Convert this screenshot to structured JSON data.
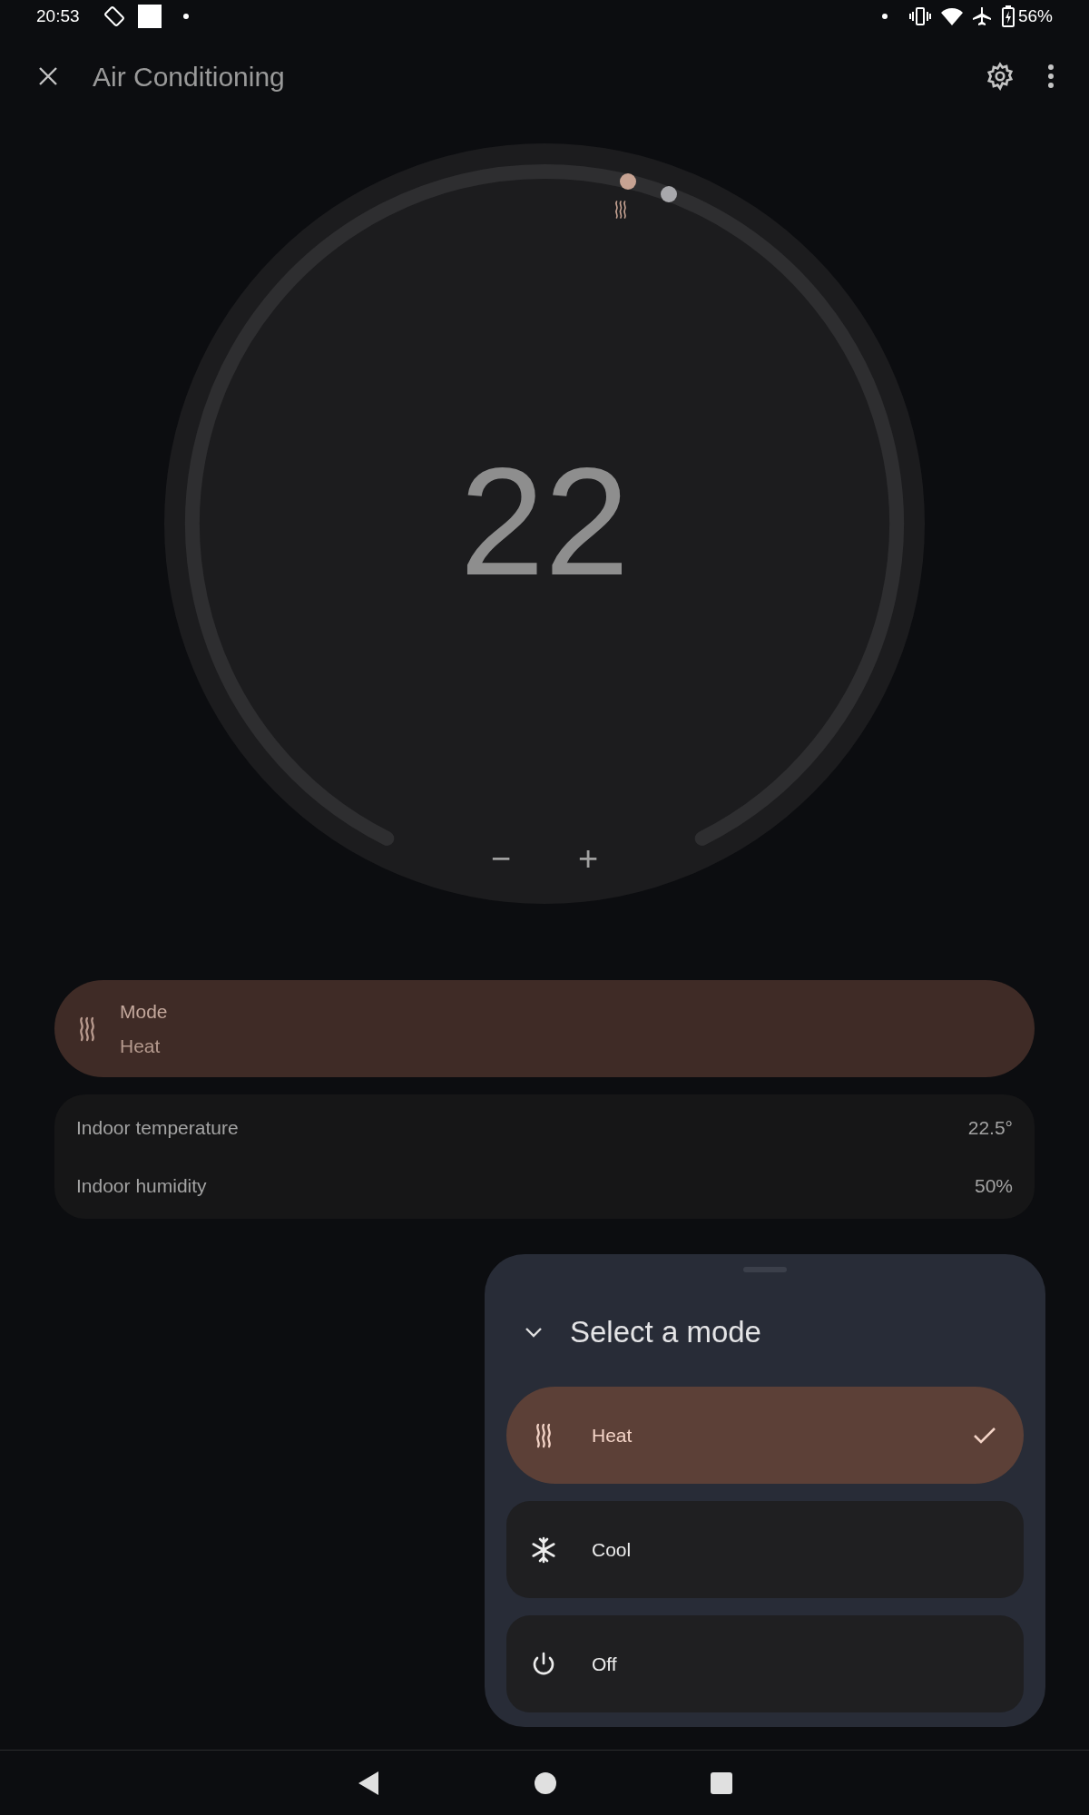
{
  "status_bar": {
    "time": "20:53",
    "battery": "56%"
  },
  "top_bar": {
    "title": "Air Conditioning"
  },
  "thermostat": {
    "setpoint": "22",
    "buttons": [
      "−",
      "+"
    ]
  },
  "mode_card": {
    "label": "Mode",
    "value": "Heat",
    "kind": "heat"
  },
  "readings": [
    {
      "label": "Indoor temperature",
      "value": "22.5°"
    },
    {
      "label": "Indoor humidity",
      "value": "50%"
    }
  ],
  "mode_sheet": {
    "title": "Select a mode",
    "options": [
      {
        "label": "Heat",
        "kind": "heat",
        "selected": true
      },
      {
        "label": "Cool",
        "kind": "cool",
        "selected": false
      },
      {
        "label": "Off",
        "kind": "off",
        "selected": false
      }
    ]
  }
}
